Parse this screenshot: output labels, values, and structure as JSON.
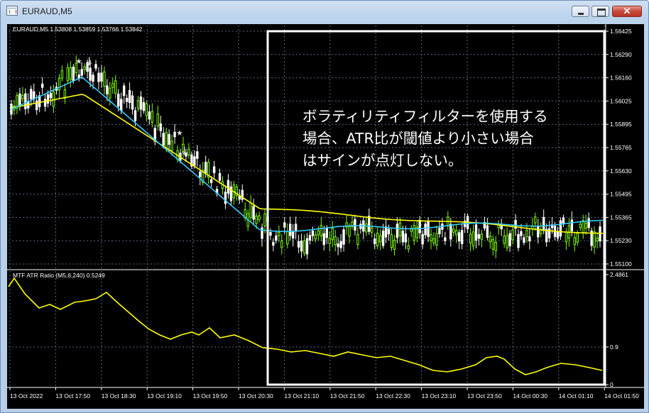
{
  "window": {
    "title": "EURAUD,M5",
    "minimize_icon": "minimize-icon",
    "maximize_icon": "maximize-icon",
    "close_icon": "close-icon",
    "close_glyph": "✕"
  },
  "main_chart": {
    "header": "EURAUD,M5  1.53808 1.53859 1.53766 1.53842",
    "price_ticks": [
      "1.56425",
      "1.56290",
      "1.56160",
      "1.56025",
      "1.55895",
      "1.55765",
      "1.55630",
      "1.55495",
      "1.55365",
      "1.55230",
      "1.55100"
    ],
    "arrow_up_mark": "↓",
    "star_mark": "★"
  },
  "indicator": {
    "header": "MTF ATR Ratio  (M5,6,240) 0.5249",
    "ticks": [
      "2.4861",
      "0.9",
      "0"
    ]
  },
  "time_axis": {
    "labels": [
      "13 Oct 2022",
      "13 Oct 17:50",
      "13 Oct 18:30",
      "13 Oct 19:10",
      "13 Oct 19:50",
      "13 Oct 20:30",
      "13 Oct 21:10",
      "13 Oct 21:50",
      "13 Oct 22:30",
      "13 Oct 23:10",
      "13 Oct 23:50",
      "14 Oct 00:30",
      "14 Oct 01:10",
      "14 Oct 01:50"
    ]
  },
  "annotation": {
    "line1": "ボラティリティフィルターを使用する",
    "line2": "場合、ATR比が閾値より小さい場合",
    "line3": "はサインが点灯しない。"
  },
  "colors": {
    "background": "#000000",
    "bull_candle": "#7CFC00",
    "bear_candle": "#ffffff",
    "ma_fast": "#33ccff",
    "ma_slow": "#ffff00",
    "atr_line": "#ffff00",
    "grid": "#5a6a7a",
    "highlight_box": "#ffffff"
  }
}
